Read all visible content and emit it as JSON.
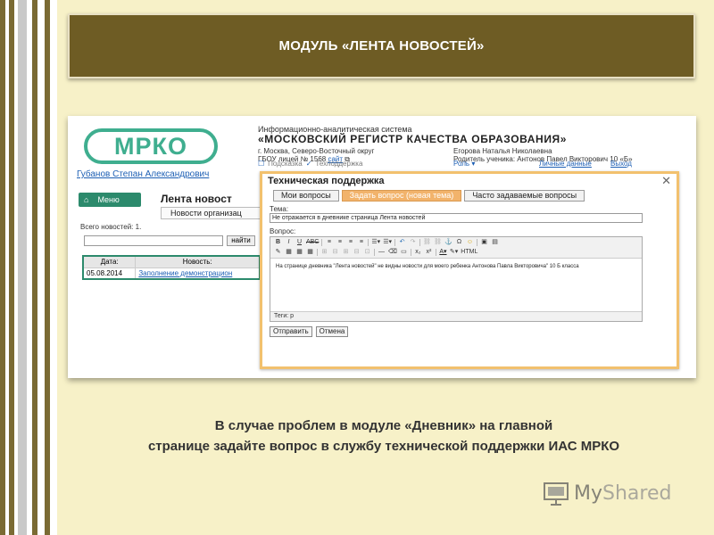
{
  "slide": {
    "title": "МОДУЛЬ «ЛЕНТА НОВОСТЕЙ»",
    "caption_line1": "В случае проблем в модуле «Дневник» на главной",
    "caption_line2": "странице задайте вопрос в службу технической поддержки ИАС МРКО"
  },
  "screenshot": {
    "logo": "МРКО",
    "system_line1": "Информационно-аналитическая система",
    "system_line2": "«МОСКОВСКИЙ РЕГИСТР КАЧЕСТВА ОБРАЗОВАНИЯ»",
    "location_line1": "г. Москва, Северо-Восточный округ",
    "location_line2_prefix": "ГБОУ лицей № 1568",
    "location_line2_link": "сайт",
    "user_line1": "Егорова Наталья Николаевна",
    "user_line2": "Родитель ученика: Антонов Павел Викторович 10 «Б»",
    "user_name": "Губанов Степан Александрович",
    "link_help": "Подсказка",
    "link_support": "Техподдержка",
    "role_label": "Роль",
    "personal_data": "Личные данные",
    "logout": "Выход",
    "menu_label": "Меню",
    "page_title": "Лента новост",
    "news_tab": "Новости организац",
    "total_news": "Всего новостей: 1.",
    "search_value": "",
    "find_button": "найти",
    "table": {
      "col_date": "Дата:",
      "col_news": "Новость:",
      "rows": [
        {
          "date": "05.08.2014",
          "news": "Заполнение демонстрацион"
        }
      ]
    }
  },
  "dialog": {
    "title": "Техническая поддержка",
    "close": "✕",
    "tabs": [
      {
        "label": "Мои вопросы"
      },
      {
        "label": "Задать вопрос (новая тема)"
      },
      {
        "label": "Часто задаваемые вопросы"
      }
    ],
    "topic_label": "Тема:",
    "topic_value": "Не отражается в дневнике страница Лента новостей",
    "question_label": "Вопрос:",
    "question_text": "На странице дневника \"Лента новостей\" не видны новости для моего ребенка Антонова Павла Викторовича\" 10 Б класса",
    "status_bar": "Теги: p",
    "submit": "Отправить",
    "cancel": "Отмена"
  },
  "watermark": {
    "my": "My",
    "shared": "Shared"
  },
  "colors": {
    "banner": "#6e5c24",
    "slide_bg": "#f7f1c8",
    "accent_green": "#2c8a6c",
    "active_tab": "#f2b36b"
  }
}
